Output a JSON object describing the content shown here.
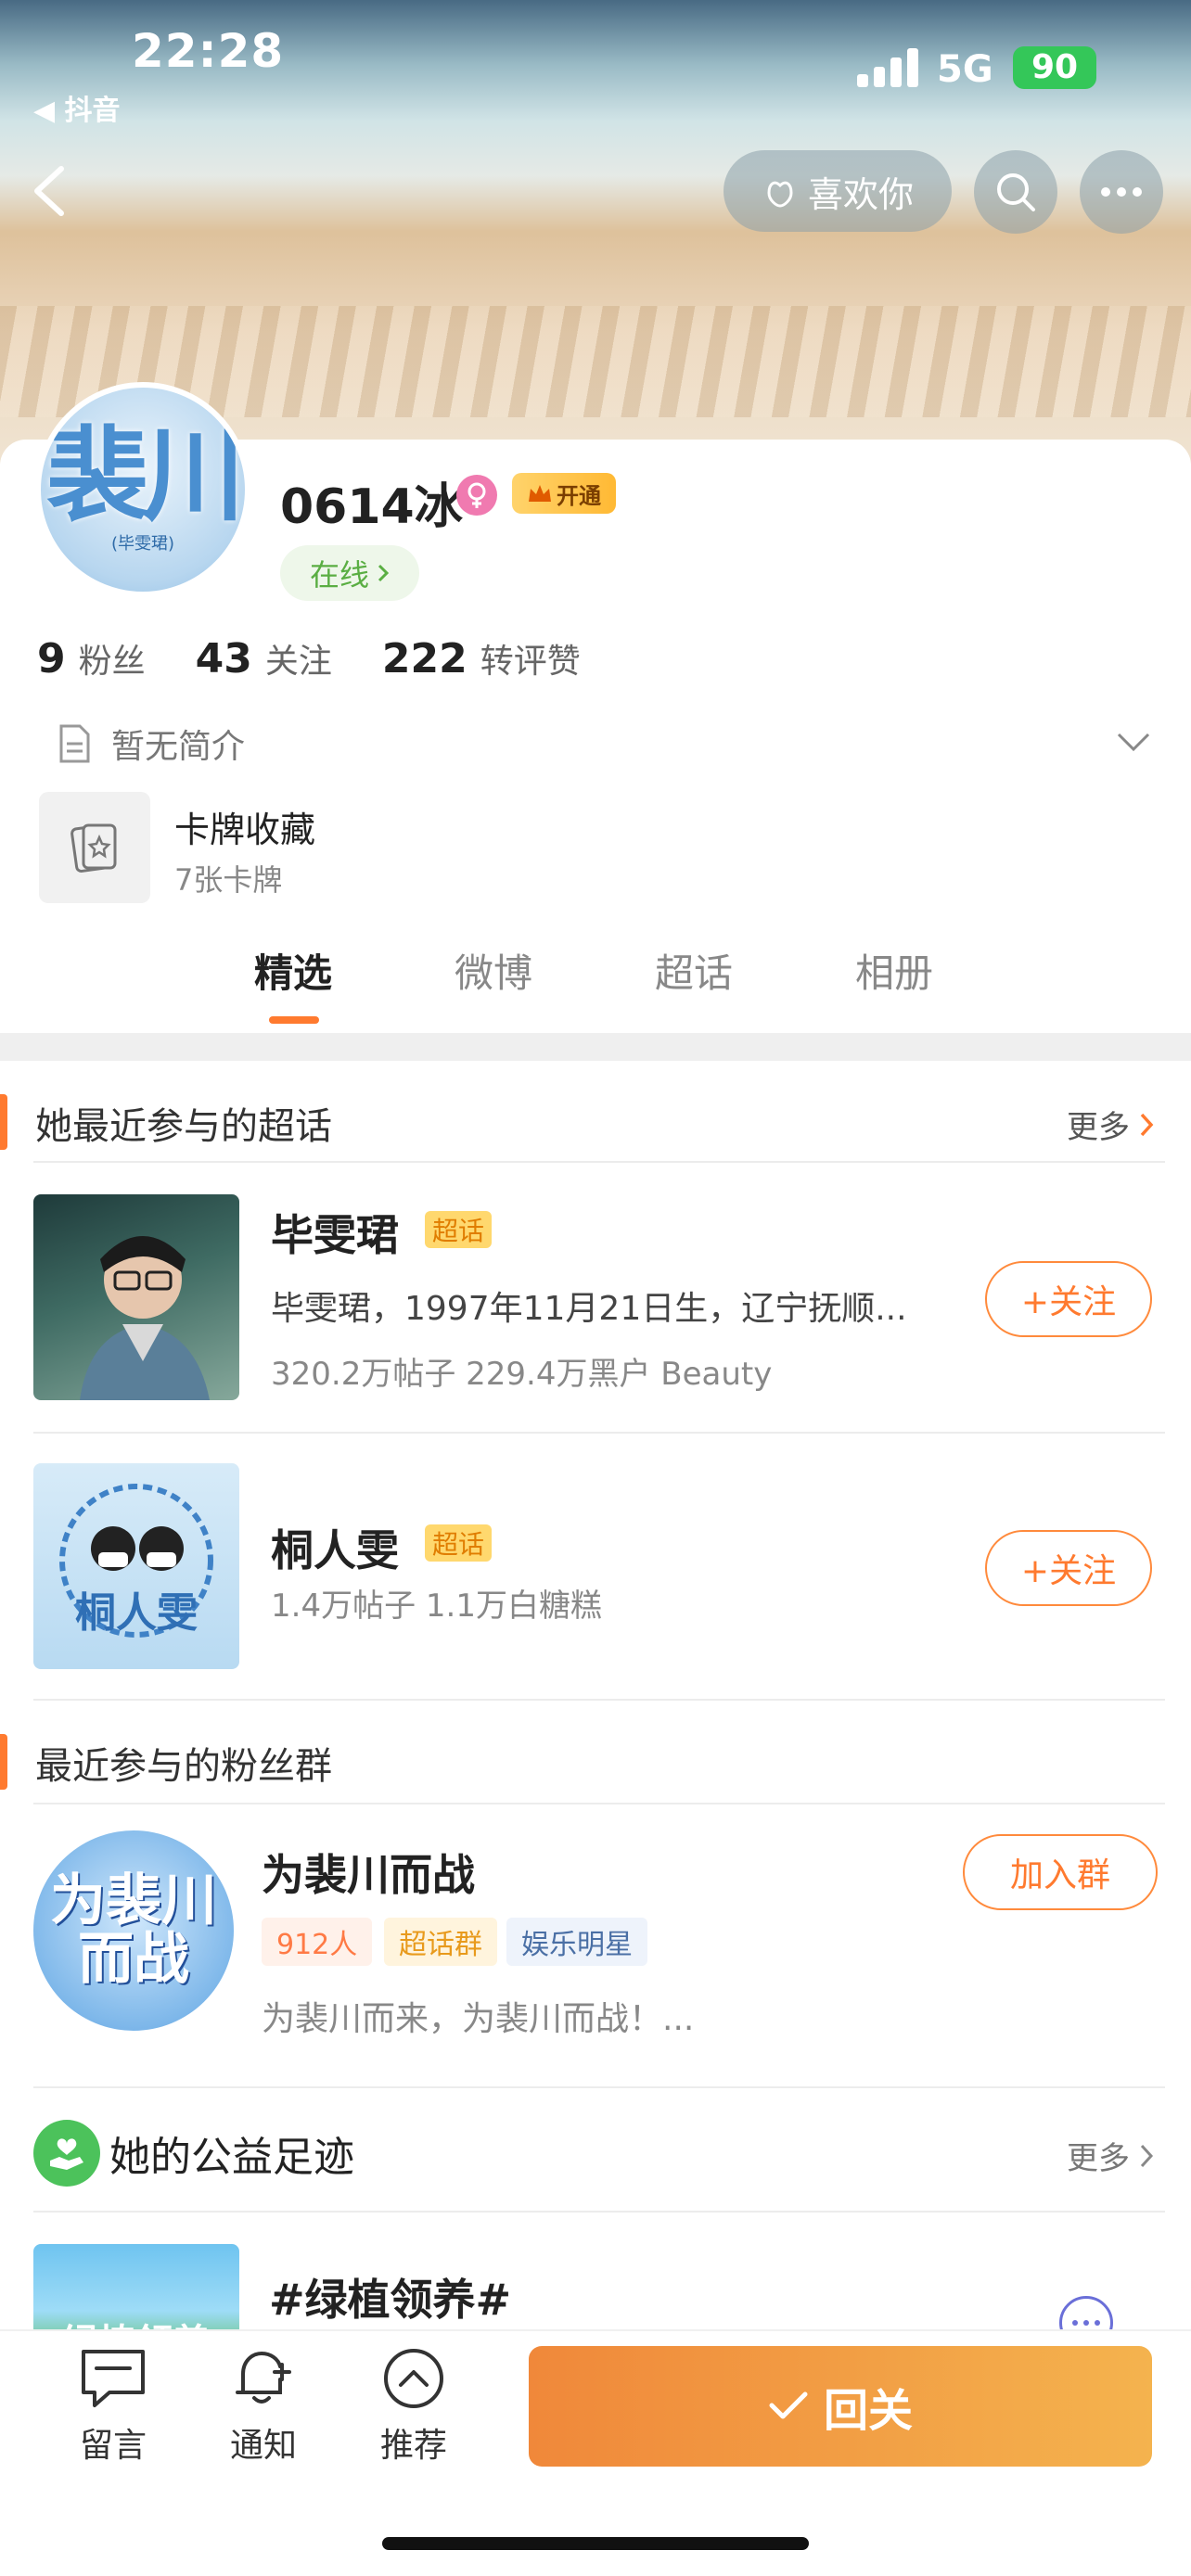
{
  "status_bar": {
    "time": "22:28",
    "back_app": "◀ 抖音",
    "network": "5G",
    "battery": "90"
  },
  "header": {
    "like_label": "喜欢你"
  },
  "profile": {
    "avatar_text": "裴川",
    "avatar_sub": "(毕雯珺)",
    "username": "0614冰",
    "vip_label": "开通",
    "online_label": "在线",
    "stats": [
      {
        "num": "9",
        "label": "粉丝"
      },
      {
        "num": "43",
        "label": "关注"
      },
      {
        "num": "222",
        "label": "转评赞"
      }
    ],
    "bio": "暂无简介",
    "collection_title": "卡牌收藏",
    "collection_sub": "7张卡牌"
  },
  "tabs": [
    "精选",
    "微博",
    "超话",
    "相册"
  ],
  "supertopics": {
    "header": "她最近参与的超话",
    "more": "更多",
    "items": [
      {
        "name": "毕雯珺",
        "tag": "超话",
        "desc": "毕雯珺，1997年11月21日生，辽宁抚顺...",
        "meta": "320.2万帖子 229.4万黑户 Beauty",
        "follow": "+关注"
      },
      {
        "name": "桐人雯",
        "tag": "超话",
        "desc": "",
        "meta": "1.4万帖子 1.1万白糖糕",
        "follow": "+关注"
      }
    ]
  },
  "fan_groups": {
    "header": "最近参与的粉丝群",
    "group": {
      "avatar_line1": "为裴川",
      "avatar_line2": "而战",
      "name": "为裴川而战",
      "join": "加入群",
      "tags": [
        "912人",
        "超话群",
        "娱乐明星"
      ],
      "desc": "为裴川而来，为裴川而战！..."
    }
  },
  "charity": {
    "header": "她的公益足迹",
    "more": "更多",
    "item_thumb": "绿植领养",
    "item_title": "#绿植领养#"
  },
  "bottom_bar": {
    "items": [
      "留言",
      "通知",
      "推荐"
    ],
    "primary": "回关"
  },
  "colors": {
    "accent": "#ff7a2f",
    "online": "#5aae43",
    "battery": "#34c759"
  }
}
